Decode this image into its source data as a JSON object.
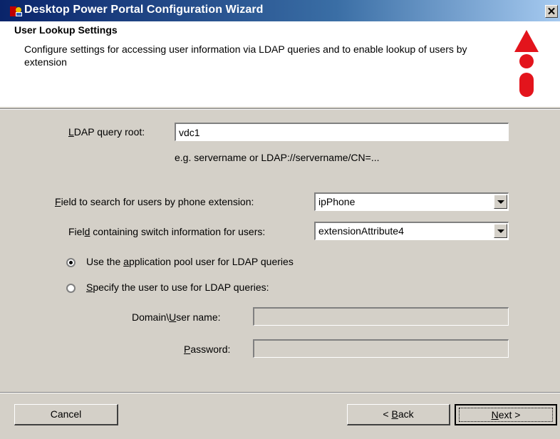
{
  "window": {
    "title": "Desktop Power Portal Configuration Wizard",
    "close_label": "✕"
  },
  "header": {
    "title": "User Lookup Settings",
    "description": "Configure settings for accessing user information via LDAP queries and to enable lookup of users by extension"
  },
  "form": {
    "ldap_root": {
      "label_mnemonic": "L",
      "label_rest": "DAP query root:",
      "value": "vdc1",
      "hint": "e.g. servername or LDAP://servername/CN=..."
    },
    "phone_field": {
      "label_mnemonic": "F",
      "label_rest": "ield to search for users by phone extension:",
      "value": "ipPhone"
    },
    "switch_field": {
      "label_pre": "Fiel",
      "label_mnemonic": "d",
      "label_rest": " containing switch information for users:",
      "value": "extensionAttribute4"
    },
    "radio_app_pool": {
      "label_pre": "Use the ",
      "label_mnemonic": "a",
      "label_rest": "pplication pool user for LDAP queries",
      "checked": true
    },
    "radio_specify": {
      "label_mnemonic": "S",
      "label_rest": "pecify the user to use for LDAP queries:",
      "checked": false
    },
    "domain_user": {
      "label_pre": "Domain\\",
      "label_mnemonic": "U",
      "label_rest": "ser name:",
      "value": ""
    },
    "password": {
      "label_mnemonic": "P",
      "label_rest": "assword:",
      "value": ""
    }
  },
  "buttons": {
    "cancel": "Cancel",
    "back_pre": "< ",
    "back_mnemonic": "B",
    "back_rest": "ack",
    "next_mnemonic": "N",
    "next_rest": "ext >"
  }
}
